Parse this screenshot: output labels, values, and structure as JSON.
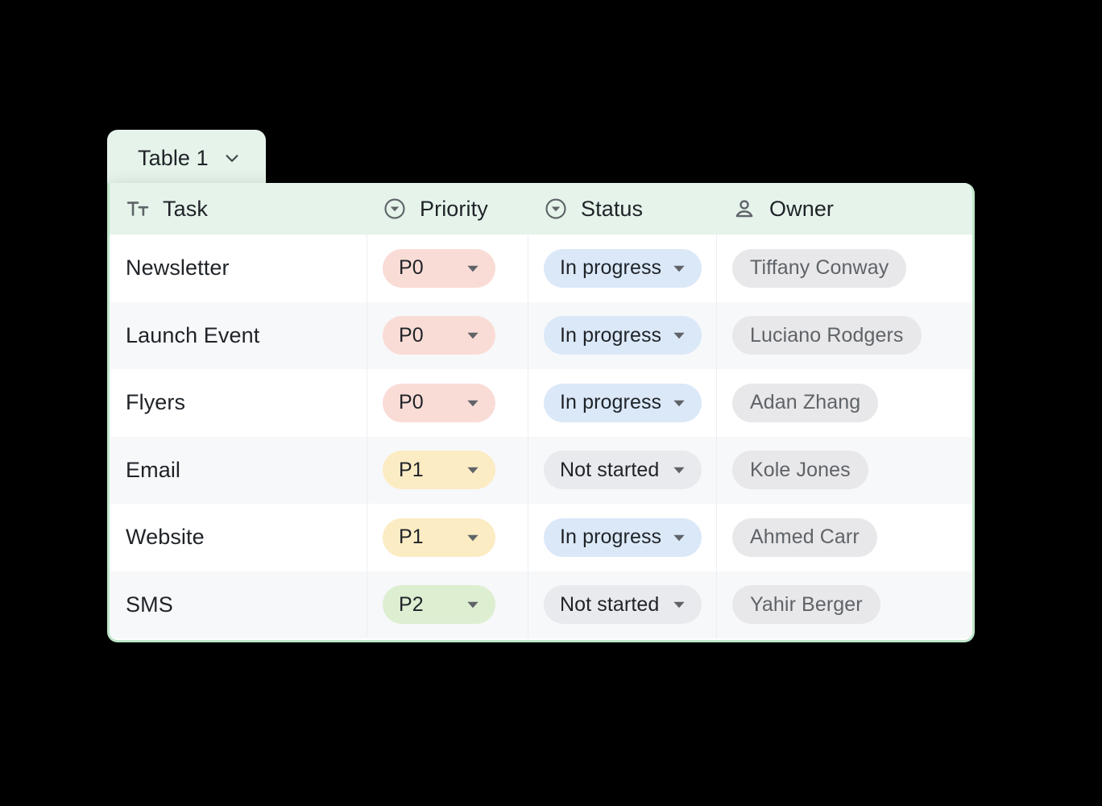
{
  "tab": {
    "label": "Table 1",
    "caret_icon": "chevron-down-icon"
  },
  "colors": {
    "header_bg": "#e5f3ea",
    "card_border": "#bfe6c9",
    "row_alt_bg": "#f7f8fa",
    "priority_p0": "#fadcd6",
    "priority_p1": "#fcecc4",
    "priority_p2": "#ddeed1",
    "status_in_progress": "#dbe8f8",
    "status_not_started": "#e8eaed",
    "owner_chip": "#e8e8ea"
  },
  "table": {
    "columns": [
      {
        "label": "Task",
        "icon": "text-format-icon"
      },
      {
        "label": "Priority",
        "icon": "circle-chevron-down-icon"
      },
      {
        "label": "Status",
        "icon": "circle-chevron-down-icon"
      },
      {
        "label": "Owner",
        "icon": "person-icon"
      }
    ],
    "rows": [
      {
        "task": "Newsletter",
        "priority": "P0",
        "status": "In progress",
        "owner": "Tiffany Conway"
      },
      {
        "task": "Launch Event",
        "priority": "P0",
        "status": "In progress",
        "owner": "Luciano Rodgers"
      },
      {
        "task": "Flyers",
        "priority": "P0",
        "status": "In progress",
        "owner": "Adan Zhang"
      },
      {
        "task": "Email",
        "priority": "P1",
        "status": "Not started",
        "owner": "Kole Jones"
      },
      {
        "task": "Website",
        "priority": "P1",
        "status": "In progress",
        "owner": "Ahmed Carr"
      },
      {
        "task": "SMS",
        "priority": "P2",
        "status": "Not started",
        "owner": "Yahir Berger"
      }
    ]
  }
}
